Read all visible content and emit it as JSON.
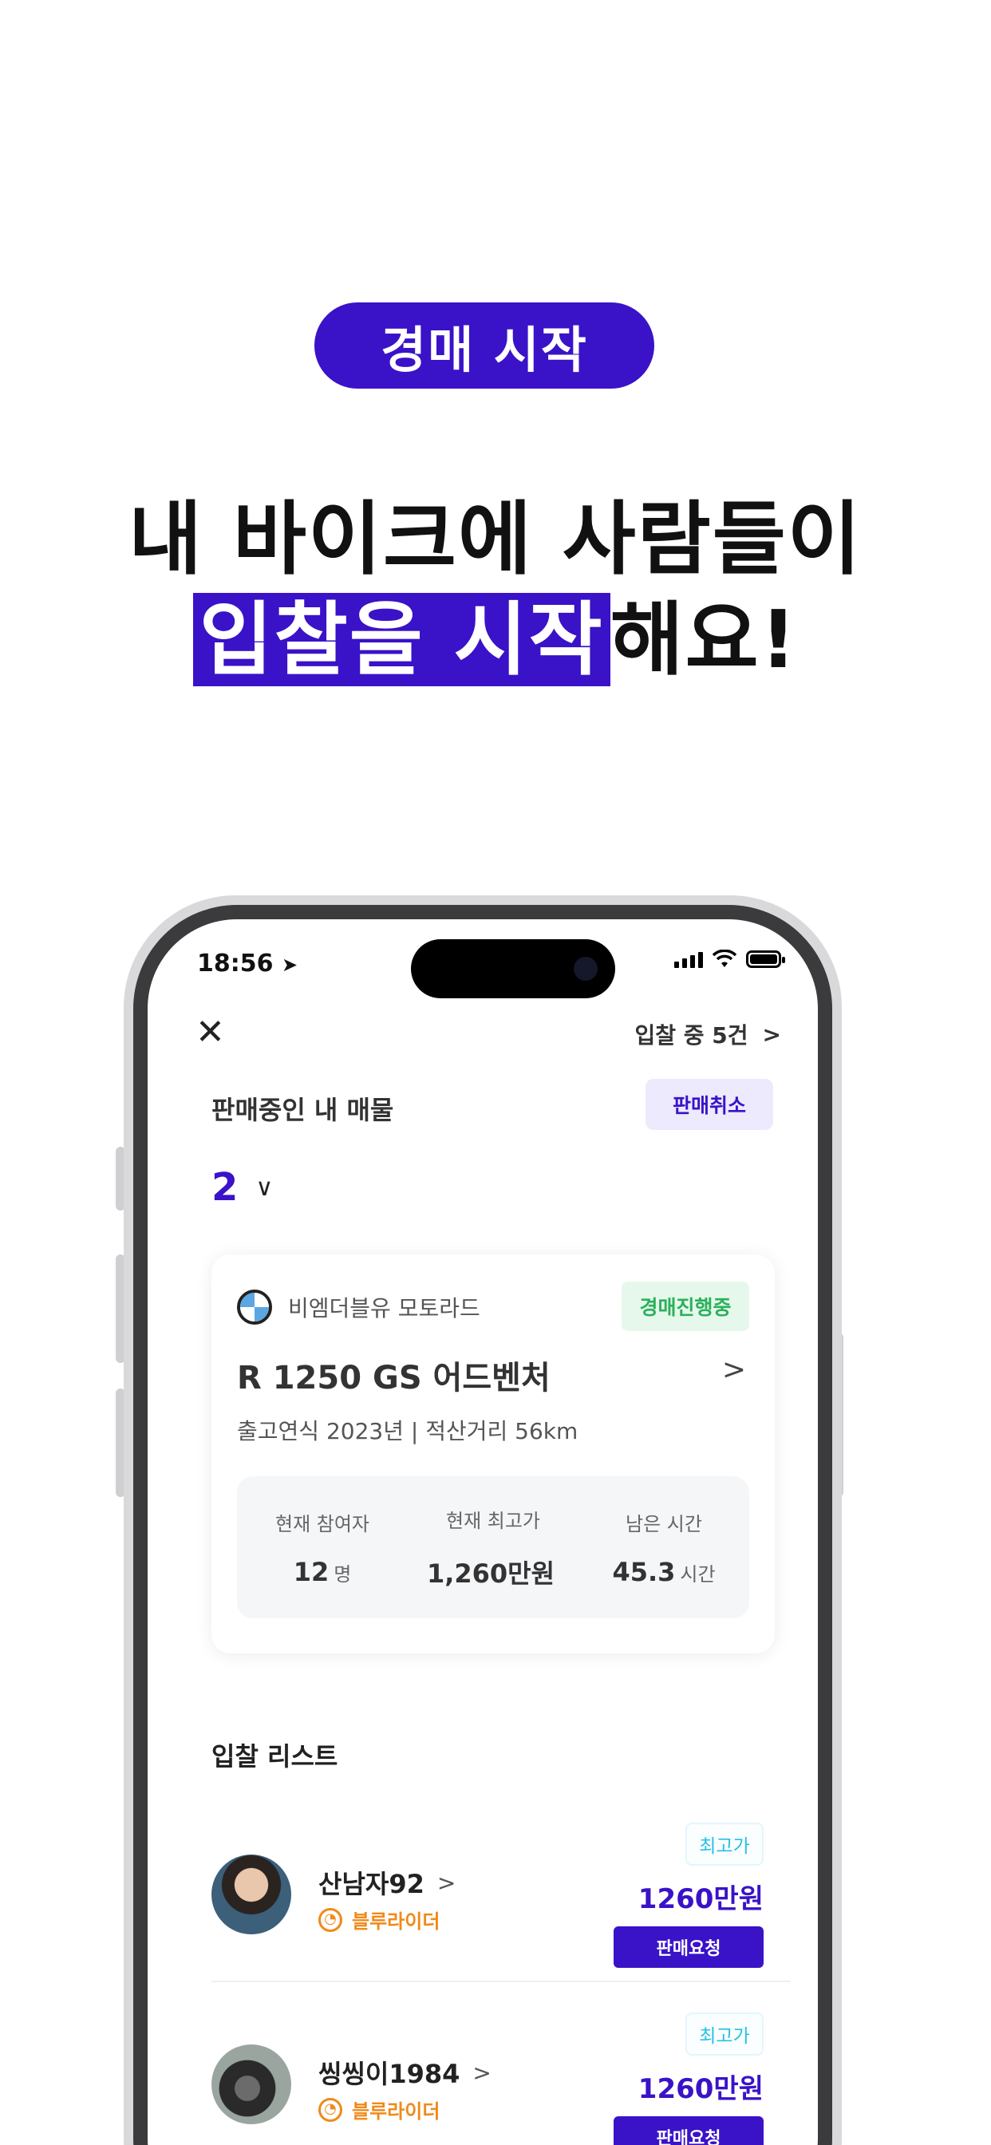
{
  "hero": {
    "badge": "경매 시작",
    "headline_line1": "내 바이크에 사람들이",
    "headline_highlight": "입찰을 시작",
    "headline_rest": "해요!",
    "accent_color": "#3a12c8"
  },
  "status_bar": {
    "time": "18:56",
    "location_icon": "location-arrow-icon",
    "signal_icon": "cellular-signal-icon",
    "wifi_icon": "wifi-icon",
    "battery_icon": "battery-icon"
  },
  "header": {
    "close_icon": "close-icon",
    "bid_count": "입찰 중 5건",
    "bid_count_chevron": ">"
  },
  "listing": {
    "section_title": "판매중인 내 매물",
    "cancel_label": "판매취소",
    "count": "2",
    "count_chevron": "∨"
  },
  "card": {
    "brand": "비엠더블유 모토라드",
    "status": "경매진행중",
    "status_color": "#2bb05b",
    "model": "R 1250 GS 어드벤처",
    "model_chevron": ">",
    "specs": "출고연식 2023년 | 적산거리 56km",
    "stats": [
      {
        "label": "현재 참여자",
        "value": "12",
        "unit": "명"
      },
      {
        "label": "현재 최고가",
        "value": "1,260만원",
        "unit": ""
      },
      {
        "label": "남은 시간",
        "value": "45.3",
        "unit": "시간"
      }
    ]
  },
  "bid_list": {
    "title": "입찰 리스트",
    "items": [
      {
        "name": "산남자92",
        "chevron": ">",
        "tier": "블루라이더",
        "badge": "최고가",
        "price": "1260만원",
        "action": "판매요청"
      },
      {
        "name": "씽씽이1984",
        "chevron": ">",
        "tier": "블루라이더",
        "badge": "최고가",
        "price": "1260만원",
        "action": "판매요청"
      }
    ]
  }
}
